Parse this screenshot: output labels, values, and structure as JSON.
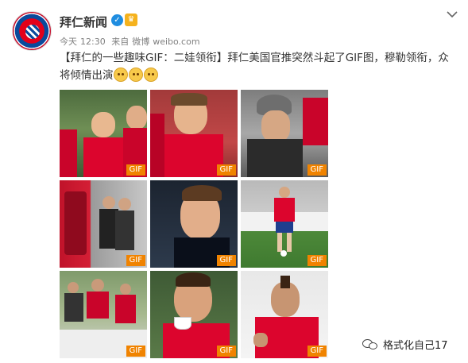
{
  "account": {
    "name": "拜仁新闻",
    "verified_icon": "verified-v-icon",
    "member_icon": "vip-badge-icon"
  },
  "meta": {
    "date": "今天",
    "time": "12:30",
    "source_prefix": "来自",
    "source": "微博",
    "site": "weibo.com"
  },
  "post": {
    "text": "【拜仁的一些趣味GIF：二娃领衔】拜仁美国官推突然斗起了GIF图，穆勒领衔，众将倾情出演",
    "emoji_count": 3,
    "emoji_name": "doge-emoji"
  },
  "gifs": [
    {
      "badge": "GIF"
    },
    {
      "badge": "GIF"
    },
    {
      "badge": "GIF"
    },
    {
      "badge": "GIF"
    },
    {
      "badge": "GIF"
    },
    {
      "badge": "GIF"
    },
    {
      "badge": "GIF"
    },
    {
      "badge": "GIF"
    },
    {
      "badge": "GIF"
    }
  ],
  "watermark": {
    "text": "格式化自己17",
    "icon": "wechat-icon"
  },
  "colors": {
    "gif_badge": "#f08300",
    "verified": "#1f8de0",
    "bayern_red": "#dc052d"
  }
}
